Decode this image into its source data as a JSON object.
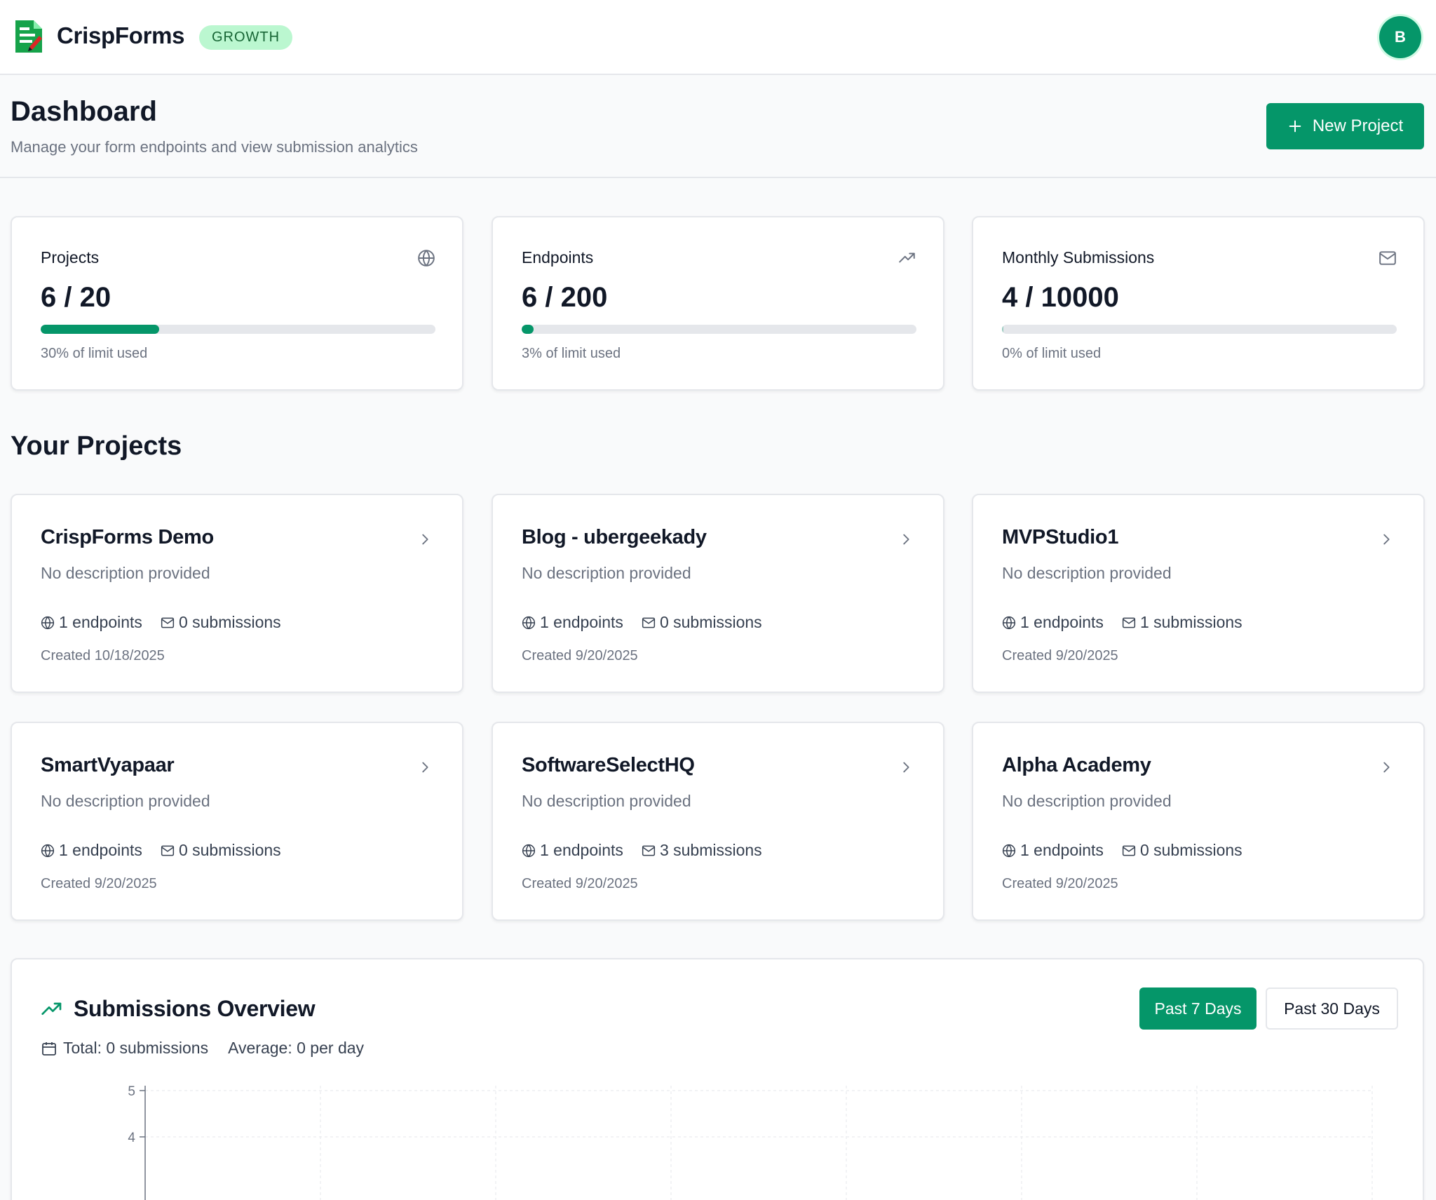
{
  "app": {
    "name": "CrispForms",
    "plan": "GROWTH",
    "avatar_initial": "B"
  },
  "header": {
    "title": "Dashboard",
    "subtitle": "Manage your form endpoints and view submission analytics",
    "new_project_label": "New Project"
  },
  "stats": [
    {
      "label": "Projects",
      "value": "6 / 20",
      "used": 6,
      "limit": 20,
      "percent": 30,
      "caption": "30% of limit used",
      "icon": "globe-icon"
    },
    {
      "label": "Endpoints",
      "value": "6 / 200",
      "used": 6,
      "limit": 200,
      "percent": 3,
      "caption": "3% of limit used",
      "icon": "trending-up-icon"
    },
    {
      "label": "Monthly Submissions",
      "value": "4 / 10000",
      "used": 4,
      "limit": 10000,
      "percent": 0,
      "caption": "0% of limit used",
      "icon": "mail-icon"
    }
  ],
  "projects_section": {
    "title": "Your Projects"
  },
  "projects": [
    {
      "name": "CrispForms Demo",
      "description": "No description provided",
      "endpoints": "1 endpoints",
      "submissions": "0 submissions",
      "created": "Created 10/18/2025"
    },
    {
      "name": "Blog - ubergeekady",
      "description": "No description provided",
      "endpoints": "1 endpoints",
      "submissions": "0 submissions",
      "created": "Created 9/20/2025"
    },
    {
      "name": "MVPStudio1",
      "description": "No description provided",
      "endpoints": "1 endpoints",
      "submissions": "1 submissions",
      "created": "Created 9/20/2025"
    },
    {
      "name": "SmartVyapaar",
      "description": "No description provided",
      "endpoints": "1 endpoints",
      "submissions": "0 submissions",
      "created": "Created 9/20/2025"
    },
    {
      "name": "SoftwareSelectHQ",
      "description": "No description provided",
      "endpoints": "1 endpoints",
      "submissions": "3 submissions",
      "created": "Created 9/20/2025"
    },
    {
      "name": "Alpha Academy",
      "description": "No description provided",
      "endpoints": "1 endpoints",
      "submissions": "0 submissions",
      "created": "Created 9/20/2025"
    }
  ],
  "overview": {
    "title": "Submissions Overview",
    "total": "Total: 0 submissions",
    "average": "Average: 0 per day",
    "ranges": [
      "Past 7 Days",
      "Past 30 Days"
    ],
    "active_range": "Past 7 Days"
  },
  "colors": {
    "accent": "#059669",
    "badge_bg": "#bbf7d0",
    "badge_text": "#166534"
  },
  "chart_data": {
    "type": "line",
    "y_ticks": [
      5,
      4
    ],
    "ylim": [
      0,
      5
    ],
    "grid": true,
    "series": []
  }
}
